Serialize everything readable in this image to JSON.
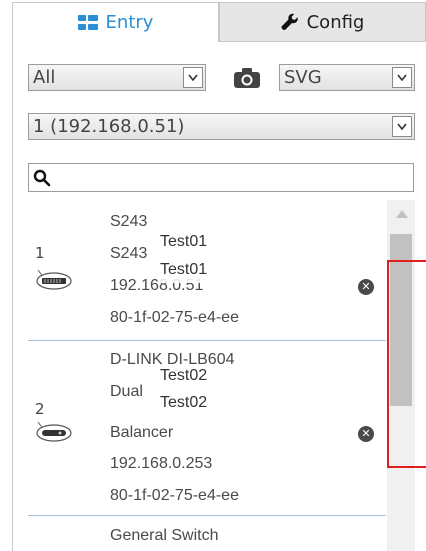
{
  "tabs": {
    "entry_label": "Entry",
    "config_label": "Config"
  },
  "filters": {
    "type_value": "All",
    "format_value": "SVG",
    "host_value": "1 (192.168.0.51)"
  },
  "search": {
    "value": "",
    "placeholder": ""
  },
  "devices": [
    {
      "number": "1",
      "icon": "switch-icon",
      "lines": [
        "S243",
        "S243",
        "192.168.0.51",
        "80-1f-02-75-e4-ee"
      ],
      "tags": [
        "Test01",
        "Test01"
      ]
    },
    {
      "number": "2",
      "icon": "router-icon",
      "lines": [
        "D-LINK DI-LB604",
        "Dual",
        "Balancer",
        "192.168.0.253",
        "80-1f-02-75-e4-ee"
      ],
      "tags": [
        "Test02",
        "Test02"
      ]
    },
    {
      "number": "",
      "icon": "",
      "lines": [
        "General Switch"
      ],
      "tags": []
    }
  ],
  "colors": {
    "accent": "#2b8fd6",
    "separator": "#9cc3e6",
    "highlight_box": "#e02020"
  }
}
